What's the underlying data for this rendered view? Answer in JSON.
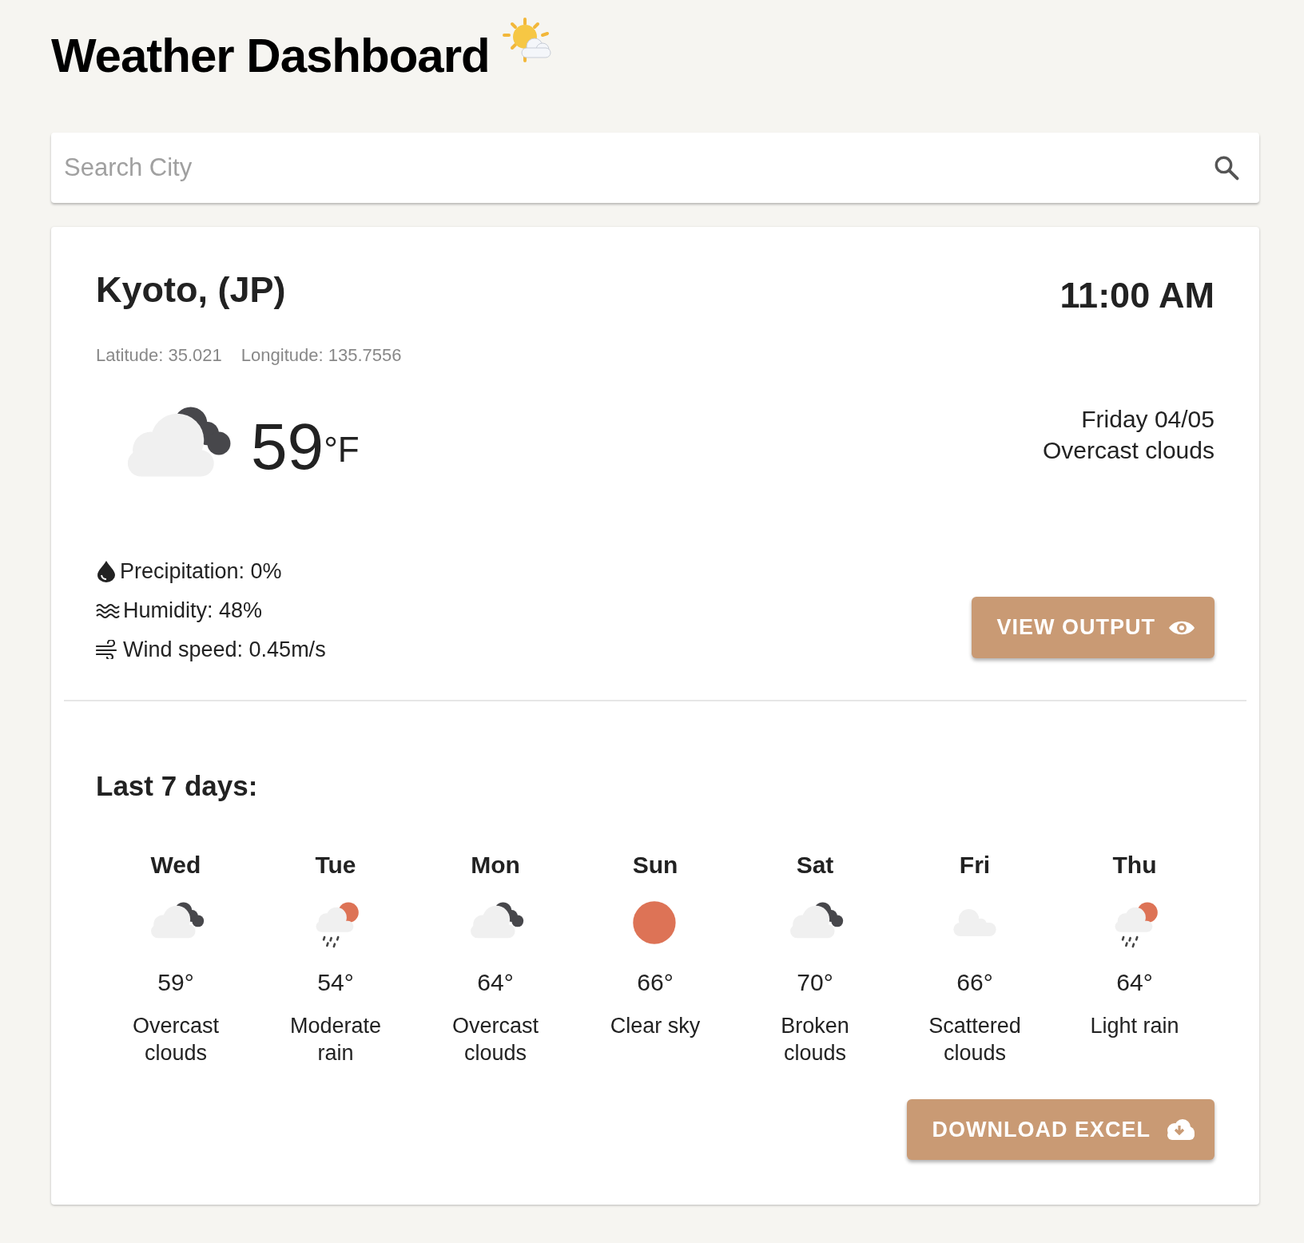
{
  "title": "Weather Dashboard",
  "search": {
    "placeholder": "Search City"
  },
  "current": {
    "city": "Kyoto, (JP)",
    "time": "11:00 AM",
    "latitude": "Latitude: 35.021",
    "longitude": "Longitude: 135.7556",
    "kind": "overcast",
    "temperature": "59",
    "unit": "°F",
    "date": "Friday 04/05",
    "description": "Overcast clouds",
    "details": [
      {
        "kind": "precipitation",
        "text": "Precipitation: 0%"
      },
      {
        "kind": "humidity",
        "text": "Humidity: 48%"
      },
      {
        "kind": "wind",
        "text": "Wind speed: 0.45m/s"
      }
    ],
    "button": "VIEW OUTPUT"
  },
  "history": {
    "heading": "Last 7 days:",
    "days": [
      {
        "day": "Wed",
        "kind": "overcast",
        "temp": "59°",
        "description": "Overcast clouds"
      },
      {
        "day": "Tue",
        "kind": "rain",
        "temp": "54°",
        "description": "Moderate rain"
      },
      {
        "day": "Mon",
        "kind": "overcast",
        "temp": "64°",
        "description": "Overcast clouds"
      },
      {
        "day": "Sun",
        "kind": "clear",
        "temp": "66°",
        "description": "Clear sky"
      },
      {
        "day": "Sat",
        "kind": "broken",
        "temp": "70°",
        "description": "Broken clouds"
      },
      {
        "day": "Fri",
        "kind": "scattered",
        "temp": "66°",
        "description": "Scattered clouds"
      },
      {
        "day": "Thu",
        "kind": "rain",
        "temp": "64°",
        "description": "Light rain"
      }
    ],
    "button": "DOWNLOAD EXCEL"
  }
}
